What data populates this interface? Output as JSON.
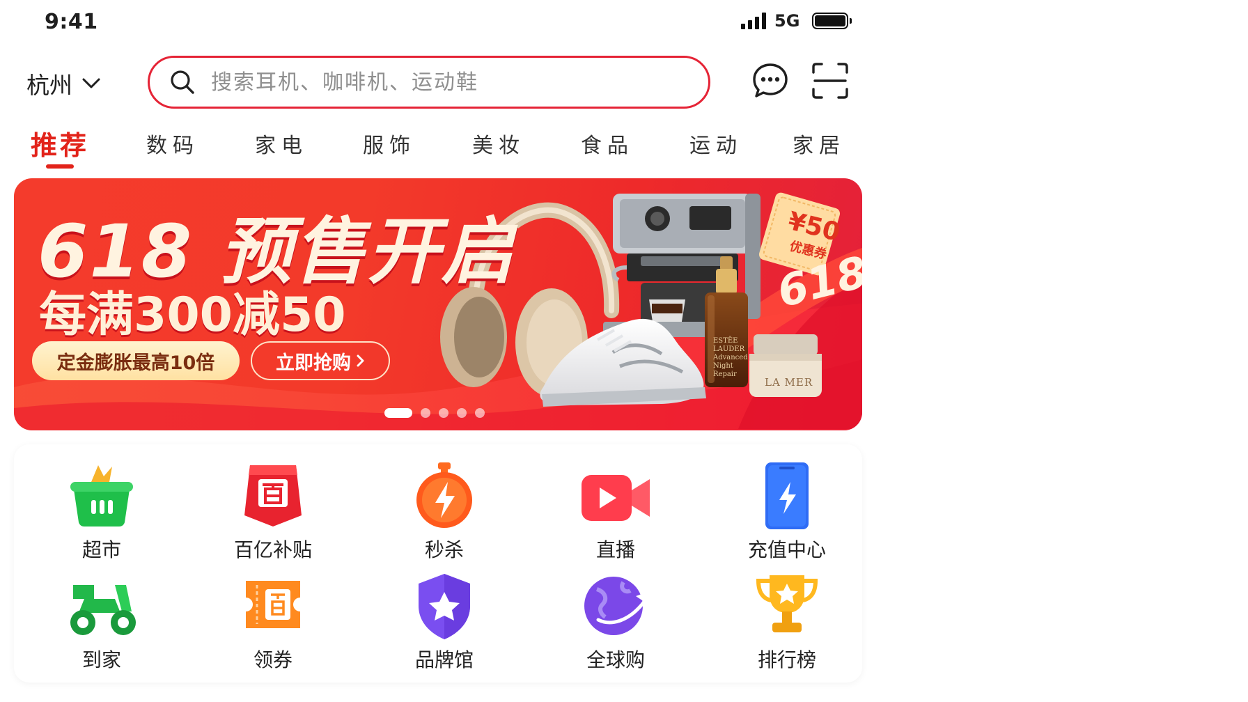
{
  "status_bar": {
    "time": "9:41",
    "network": "5G"
  },
  "header": {
    "city": "杭州",
    "search_placeholder": "搜索耳机、咖啡机、运动鞋"
  },
  "tabs": [
    {
      "label": "推荐",
      "active": true
    },
    {
      "label": "数码"
    },
    {
      "label": "家电"
    },
    {
      "label": "服饰"
    },
    {
      "label": "美妆"
    },
    {
      "label": "食品"
    },
    {
      "label": "运动"
    },
    {
      "label": "家居"
    }
  ],
  "banner": {
    "title": "618 预售开启",
    "subtitle": "每满300减50",
    "pill_deposit": "定金膨胀最高10倍",
    "pill_buy": "立即抢购",
    "coupon_amount": "¥50",
    "coupon_label": "优惠券",
    "ribbon_text": "618",
    "lamer_label": "LA MER",
    "estee_label": "ESTĒE LAUDER Advanced Night Repair",
    "slide_count": 5,
    "active_slide": 1
  },
  "categories": [
    {
      "label": "超市",
      "icon": "basket-icon"
    },
    {
      "label": "百亿补贴",
      "icon": "subsidy-icon"
    },
    {
      "label": "秒杀",
      "icon": "stopwatch-icon"
    },
    {
      "label": "直播",
      "icon": "video-camera-icon"
    },
    {
      "label": "充值中心",
      "icon": "phone-bolt-icon"
    },
    {
      "label": "到家",
      "icon": "scooter-icon"
    },
    {
      "label": "领券",
      "icon": "coupon-icon"
    },
    {
      "label": "品牌馆",
      "icon": "shield-star-icon"
    },
    {
      "label": "全球购",
      "icon": "globe-plane-icon"
    },
    {
      "label": "排行榜",
      "icon": "trophy-icon"
    }
  ],
  "colors": {
    "accent": "#e52436",
    "banner_red": "#f33a2a",
    "gold": "#ffe1a2"
  }
}
